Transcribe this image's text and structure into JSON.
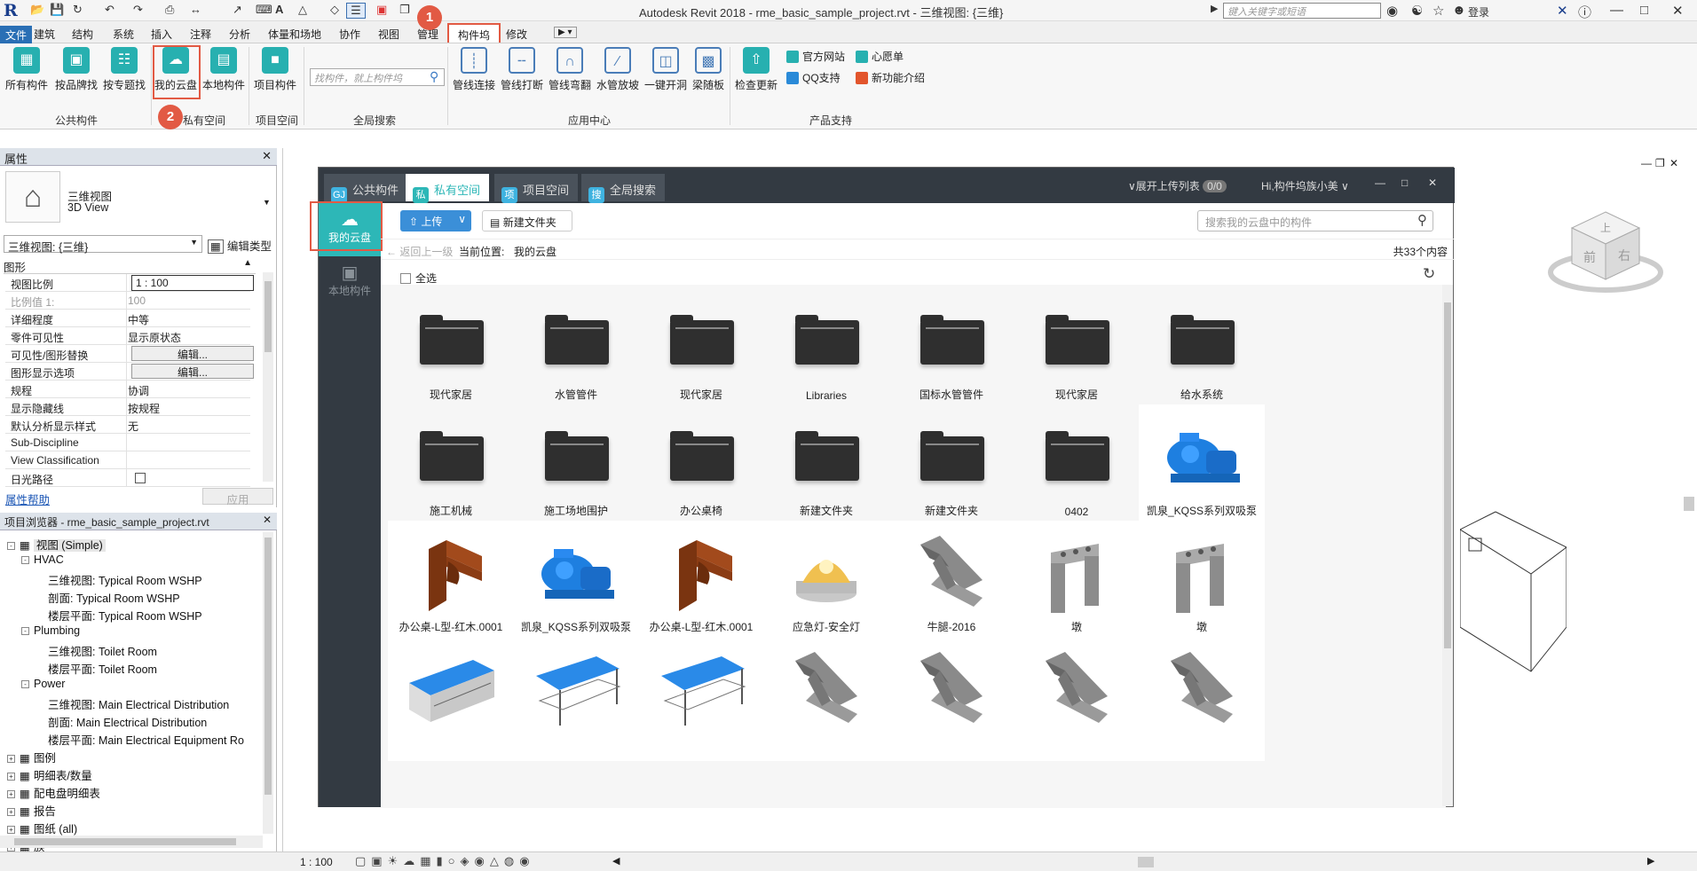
{
  "titlebar": {
    "title": "Autodesk Revit 2018 -   rme_basic_sample_project.rvt - 三维视图: {三维}",
    "help_search_placeholder": "键入关键字或短语",
    "login_label": "登录"
  },
  "ribbon_tabs": [
    "文件",
    "建筑",
    "结构",
    "系统",
    "插入",
    "注释",
    "分析",
    "体量和场地",
    "协作",
    "视图",
    "管理",
    "构件坞",
    "修改"
  ],
  "ribbon": {
    "public": {
      "items": [
        "所有构件",
        "按品牌找",
        "按专题找"
      ],
      "group": "公共构件"
    },
    "private": {
      "items": [
        "我的云盘",
        "本地构件"
      ],
      "group": "私有空间"
    },
    "project": {
      "items": [
        "项目构件"
      ],
      "group": "项目空间"
    },
    "global_search": {
      "placeholder": "找构件，就上构件坞",
      "group": "全局搜索"
    },
    "apps": {
      "items": [
        "管线连接",
        "管线打断",
        "管线弯翻",
        "水管放坡",
        "一键开洞",
        "梁随板"
      ],
      "group": "应用中心"
    },
    "support": {
      "update": "检查更新",
      "links": [
        "官方网站",
        "心愿单",
        "QQ支持",
        "新功能介绍"
      ],
      "group": "产品支持"
    }
  },
  "badges": [
    "1",
    "2"
  ],
  "properties": {
    "header": "属性",
    "type_name": "三维视图",
    "type_sub": "3D View",
    "selector": "三维视图: {三维}",
    "edit_type": "编辑类型",
    "section": "图形",
    "rows": [
      {
        "k": "视图比例",
        "v": "1 : 100"
      },
      {
        "k": "比例值 1:",
        "v": "100"
      },
      {
        "k": "详细程度",
        "v": "中等"
      },
      {
        "k": "零件可见性",
        "v": "显示原状态"
      },
      {
        "k": "可见性/图形替换",
        "v": "编辑..."
      },
      {
        "k": "图形显示选项",
        "v": "编辑..."
      },
      {
        "k": "规程",
        "v": "协调"
      },
      {
        "k": "显示隐藏线",
        "v": "按规程"
      },
      {
        "k": "默认分析显示样式",
        "v": "无"
      },
      {
        "k": "Sub-Discipline",
        "v": ""
      },
      {
        "k": "View Classification",
        "v": ""
      },
      {
        "k": "日光路径",
        "v": ""
      }
    ],
    "help_link": "属性帮助",
    "apply": "应用"
  },
  "browser": {
    "header": "项目浏览器 - rme_basic_sample_project.rvt",
    "items": [
      {
        "t": "视图 (Simple)",
        "lvl": 0,
        "sign": "-"
      },
      {
        "t": "HVAC",
        "lvl": 1,
        "sign": "-"
      },
      {
        "t": "三维视图: Typical Room WSHP",
        "lvl": 2,
        "sign": ""
      },
      {
        "t": "剖面: Typical Room WSHP",
        "lvl": 2,
        "sign": ""
      },
      {
        "t": "楼层平面: Typical Room WSHP",
        "lvl": 2,
        "sign": ""
      },
      {
        "t": "Plumbing",
        "lvl": 1,
        "sign": "-"
      },
      {
        "t": "三维视图: Toilet Room",
        "lvl": 2,
        "sign": ""
      },
      {
        "t": "楼层平面: Toilet Room",
        "lvl": 2,
        "sign": ""
      },
      {
        "t": "Power",
        "lvl": 1,
        "sign": "-"
      },
      {
        "t": "三维视图: Main Electrical Distribution",
        "lvl": 2,
        "sign": ""
      },
      {
        "t": "剖面: Main Electrical Distribution",
        "lvl": 2,
        "sign": ""
      },
      {
        "t": "楼层平面: Main Electrical Equipment Ro",
        "lvl": 2,
        "sign": ""
      },
      {
        "t": "图例",
        "lvl": 0,
        "sign": "+"
      },
      {
        "t": "明细表/数量",
        "lvl": 0,
        "sign": "+"
      },
      {
        "t": "配电盘明细表",
        "lvl": 0,
        "sign": "+"
      },
      {
        "t": "报告",
        "lvl": 0,
        "sign": "+"
      },
      {
        "t": "图纸 (all)",
        "lvl": 0,
        "sign": "+"
      },
      {
        "t": "族",
        "lvl": 0,
        "sign": "+"
      }
    ]
  },
  "status": {
    "scale": "1 : 100"
  },
  "viewcube": {
    "face_top": "上",
    "face_front": "前",
    "face_right": "右"
  },
  "dialog": {
    "tabs": [
      {
        "icon": "GJ",
        "label": "公共构件"
      },
      {
        "icon": "私",
        "label": "私有空间"
      },
      {
        "icon": "项",
        "label": "项目空间"
      },
      {
        "icon": "搜",
        "label": "全局搜索"
      }
    ],
    "upload_list": "展开上传列表",
    "upload_count": "0/0",
    "user": "Hi,构件坞族小美",
    "side": [
      "我的云盘",
      "本地构件"
    ],
    "upload_btn": "上传",
    "new_folder": "新建文件夹",
    "search_placeholder": "搜索我的云盘中的构件",
    "back": "返回上一级",
    "location_label": "当前位置:",
    "location": "我的云盘",
    "total": "共33个内容",
    "select_all": "全选",
    "cards": [
      {
        "label": "现代家居",
        "kind": "folder"
      },
      {
        "label": "水管管件",
        "kind": "folder"
      },
      {
        "label": "现代家居",
        "kind": "folder"
      },
      {
        "label": "Libraries",
        "kind": "folder"
      },
      {
        "label": "国标水管管件",
        "kind": "folder"
      },
      {
        "label": "现代家居",
        "kind": "folder"
      },
      {
        "label": "给水系统",
        "kind": "folder"
      },
      {
        "label": "施工机械",
        "kind": "folder"
      },
      {
        "label": "施工场地围护",
        "kind": "folder"
      },
      {
        "label": "办公桌椅",
        "kind": "folder"
      },
      {
        "label": "新建文件夹",
        "kind": "folder"
      },
      {
        "label": "新建文件夹",
        "kind": "folder"
      },
      {
        "label": "0402",
        "kind": "folder"
      },
      {
        "label": "凯泉_KQSS系列双吸泵",
        "kind": "pump"
      },
      {
        "label": "办公桌-L型-红木.0001",
        "kind": "desk"
      },
      {
        "label": "凯泉_KQSS系列双吸泵",
        "kind": "pump"
      },
      {
        "label": "办公桌-L型-红木.0001",
        "kind": "desk"
      },
      {
        "label": "应急灯-安全灯",
        "kind": "lamp"
      },
      {
        "label": "牛腿-2016",
        "kind": "corbel"
      },
      {
        "label": "墩",
        "kind": "pier"
      },
      {
        "label": "墩",
        "kind": "pier"
      },
      {
        "label": "",
        "kind": "building"
      },
      {
        "label": "",
        "kind": "shed"
      },
      {
        "label": "",
        "kind": "shed"
      },
      {
        "label": "",
        "kind": "corbel"
      },
      {
        "label": "",
        "kind": "corbel"
      },
      {
        "label": "",
        "kind": "corbel"
      },
      {
        "label": "",
        "kind": "corbel"
      }
    ]
  }
}
